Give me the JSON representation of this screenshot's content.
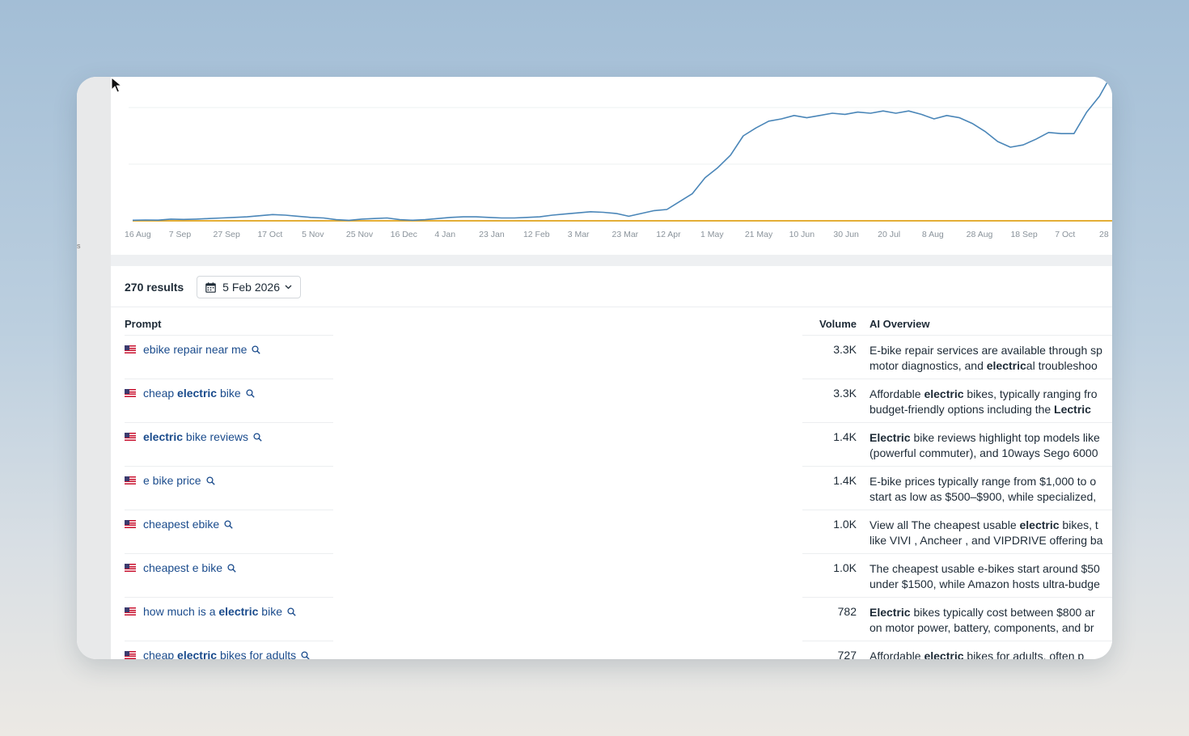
{
  "chart_data": {
    "type": "line",
    "x_ticks": [
      "16 Aug",
      "7 Sep",
      "27 Sep",
      "17 Oct",
      "5 Nov",
      "25 Nov",
      "16 Dec",
      "4 Jan",
      "23 Jan",
      "12 Feb",
      "3 Mar",
      "23 Mar",
      "12 Apr",
      "1 May",
      "21 May",
      "10 Jun",
      "30 Jun",
      "20 Jul",
      "8 Aug",
      "28 Aug",
      "18 Sep",
      "7 Oct",
      "28"
    ],
    "grid": true,
    "series": [
      {
        "color": "#4a86b8",
        "values": [
          0.5,
          0.7,
          0.6,
          1.5,
          1.2,
          1.5,
          2.0,
          2.5,
          3.0,
          3.5,
          4.5,
          5.5,
          5.0,
          4.0,
          3.0,
          2.5,
          1.0,
          0.4,
          1.5,
          2.0,
          2.5,
          1.0,
          0.5,
          1.0,
          2.0,
          3.0,
          3.5,
          3.5,
          3.0,
          2.5,
          2.5,
          3.0,
          3.5,
          5.0,
          6.0,
          7.0,
          8.0,
          7.5,
          6.5,
          4.0,
          6.5,
          9.0,
          10.0,
          17.0,
          24.0,
          38.0,
          47.0,
          58.0,
          75.0,
          82.0,
          88.0,
          90.0,
          93.0,
          91.0,
          93.0,
          95.0,
          94.0,
          96.0,
          95.0,
          97.0,
          95.0,
          97.0,
          94.0,
          90.0,
          93.0,
          91.0,
          86.0,
          79.0,
          70.0,
          65.0,
          67.0,
          72.0,
          78.0,
          77.0,
          77.0,
          96.0,
          110.0,
          130.0
        ]
      },
      {
        "color": "#e0a21a",
        "values": [
          0,
          0,
          0,
          0,
          0,
          0,
          0,
          0,
          0,
          0,
          0,
          0,
          0,
          0,
          0,
          0,
          0,
          0,
          0,
          0,
          0,
          0,
          0,
          0,
          0,
          0,
          0,
          0,
          0,
          0,
          0,
          0,
          0,
          0,
          0,
          0,
          0,
          0,
          0,
          0,
          0,
          0,
          0,
          0,
          0,
          0,
          0,
          0,
          0,
          0,
          0,
          0,
          0,
          0,
          0,
          0,
          0,
          0,
          0,
          0,
          0,
          0,
          0,
          0,
          0,
          0,
          0,
          0,
          0,
          0,
          0,
          0,
          0,
          0,
          0,
          0,
          0,
          0
        ]
      }
    ]
  },
  "toolbar": {
    "results_count": "270 results",
    "date": "5 Feb 2026",
    "calendar_icon": "calendar-icon",
    "chevron_icon": "chevron-down-icon"
  },
  "table": {
    "headers": {
      "prompt": "Prompt",
      "volume": "Volume",
      "ai_overview": "AI Overview"
    },
    "rows": [
      {
        "prompt": [
          {
            "t": "ebike repair near me",
            "b": false
          }
        ],
        "volume": "3.3K",
        "ai": [
          [
            {
              "t": "E-bike repair services are available through sp",
              "b": false
            }
          ],
          [
            {
              "t": "motor diagnostics, and ",
              "b": false
            },
            {
              "t": "electric",
              "b": true
            },
            {
              "t": "al troubleshoo",
              "b": false
            }
          ]
        ]
      },
      {
        "prompt": [
          {
            "t": "cheap ",
            "b": false
          },
          {
            "t": "electric",
            "b": true
          },
          {
            "t": " bike",
            "b": false
          }
        ],
        "volume": "3.3K",
        "ai": [
          [
            {
              "t": "Affordable ",
              "b": false
            },
            {
              "t": "electric",
              "b": true
            },
            {
              "t": " bikes, typically ranging fro",
              "b": false
            }
          ],
          [
            {
              "t": "budget-friendly options including the ",
              "b": false
            },
            {
              "t": "Lectric",
              "b": true
            }
          ]
        ]
      },
      {
        "prompt": [
          {
            "t": "electric",
            "b": true
          },
          {
            "t": " bike reviews",
            "b": false
          }
        ],
        "volume": "1.4K",
        "ai": [
          [
            {
              "t": "Electric",
              "b": true
            },
            {
              "t": " bike reviews highlight top models like",
              "b": false
            }
          ],
          [
            {
              "t": "(powerful commuter), and 10ways Sego 6000",
              "b": false
            }
          ]
        ]
      },
      {
        "prompt": [
          {
            "t": "e bike price",
            "b": false
          }
        ],
        "volume": "1.4K",
        "ai": [
          [
            {
              "t": "E-bike prices typically range from $1,000 to o",
              "b": false
            }
          ],
          [
            {
              "t": "start as low as $500–$900, while specialized,",
              "b": false
            }
          ]
        ]
      },
      {
        "prompt": [
          {
            "t": "cheapest ebike",
            "b": false
          }
        ],
        "volume": "1.0K",
        "ai": [
          [
            {
              "t": "View all The cheapest usable ",
              "b": false
            },
            {
              "t": "electric",
              "b": true
            },
            {
              "t": " bikes, t",
              "b": false
            }
          ],
          [
            {
              "t": "like VIVI , Ancheer , and VIPDRIVE offering ba",
              "b": false
            }
          ]
        ]
      },
      {
        "prompt": [
          {
            "t": "cheapest e bike",
            "b": false
          }
        ],
        "volume": "1.0K",
        "ai": [
          [
            {
              "t": "The cheapest usable e-bikes start around $50",
              "b": false
            }
          ],
          [
            {
              "t": "under $1500, while Amazon hosts ultra-budge",
              "b": false
            }
          ]
        ]
      },
      {
        "prompt": [
          {
            "t": "how much is a ",
            "b": false
          },
          {
            "t": "electric",
            "b": true
          },
          {
            "t": " bike",
            "b": false
          }
        ],
        "volume": "782",
        "ai": [
          [
            {
              "t": "Electric",
              "b": true
            },
            {
              "t": " bikes typically cost between $800 ar",
              "b": false
            }
          ],
          [
            {
              "t": "on motor power, battery, components, and br",
              "b": false
            }
          ]
        ]
      },
      {
        "prompt": [
          {
            "t": "cheap ",
            "b": false
          },
          {
            "t": "electric",
            "b": true
          },
          {
            "t": " bikes for adults",
            "b": false
          }
        ],
        "volume": "727",
        "ai": [
          [
            {
              "t": "Affordable ",
              "b": false
            },
            {
              "t": "electric",
              "b": true
            },
            {
              "t": " bikes for adults, often p",
              "b": false
            }
          ]
        ]
      }
    ]
  }
}
